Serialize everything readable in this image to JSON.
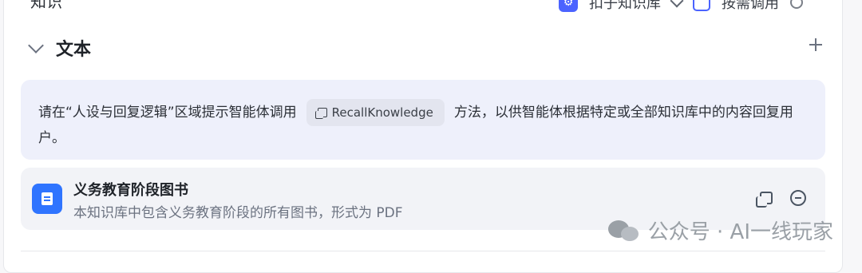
{
  "header": {
    "knowledge_label": "知识",
    "kb_selector_label": "扣子知识库",
    "call_mode_label": "按需调用"
  },
  "section": {
    "title": "文本"
  },
  "hint": {
    "text_before": "请在“人设与回复逻辑”区域提示智能体调用",
    "method_name": "RecallKnowledge",
    "text_after": "方法，以供智能体根据特定或全部知识库中的内容回复用户。"
  },
  "knowledge_item": {
    "title": "义务教育阶段图书",
    "description": "本知识库中包含义务教育阶段的所有图书，形式为 PDF"
  },
  "watermark": {
    "text": "公众号 · AI一线玩家"
  },
  "colors": {
    "accent": "#4b63ff",
    "doc_icon": "#2f74ff",
    "hint_bg": "#eef0fb",
    "item_bg": "#f2f3f7"
  }
}
